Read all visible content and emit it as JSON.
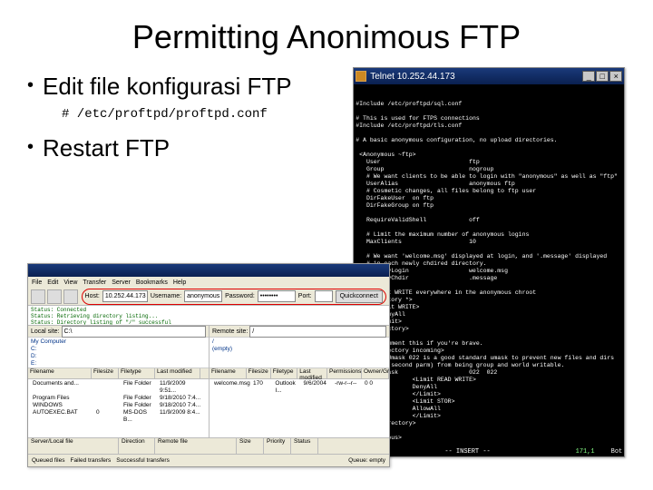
{
  "title": "Permitting Anonimous FTP",
  "bullets": {
    "edit": "Edit file konfigurasi FTP",
    "restart": "Restart FTP"
  },
  "code": "# /etc/proftpd/proftpd.conf",
  "terminal": {
    "window_title": "Telnet 10.252.44.173",
    "buttons": {
      "min": "_",
      "max": "□",
      "close": "×"
    },
    "lines": [
      "#Include /etc/proftpd/sql.conf",
      "",
      "# This is used for FTPS connections",
      "#Include /etc/proftpd/tls.conf",
      "",
      "# A basic anonymous configuration, no upload directories.",
      "",
      " <Anonymous ~ftp>",
      "   User                         ftp",
      "   Group                        nogroup",
      "   # We want clients to be able to login with \"anonymous\" as well as \"ftp\"",
      "   UserAlias                    anonymous ftp",
      "   # Cosmetic changes, all files belong to ftp user",
      "   DirFakeUser  on ftp",
      "   DirFakeGroup on ftp",
      "",
      "   RequireValidShell            off",
      "",
      "   # Limit the maximum number of anonymous logins",
      "   MaxClients                   10",
      "",
      "   # We want 'welcome.msg' displayed at login, and '.message' displayed",
      "   # in each newly chdired directory.",
      "   DisplayLogin                 welcome.msg",
      "   DisplayChdir                 .message",
      "",
      "   # Limit WRITE everywhere in the anonymous chroot",
      "   <Directory *>",
      "     <Limit WRITE>",
      "       DenyAll",
      "     </Limit>",
      "   </Directory>",
      "",
      "   # Uncomment this if you're brave.",
      "   # <Directory incoming>",
      "   #   # Umask 022 is a good standard umask to prevent new files and dirs",
      "   #   # (second parm) from being group and world writable.",
      "   #   Umask                    022  022",
      "   #            <Limit READ WRITE>",
      "   #            DenyAll",
      "   #            </Limit>",
      "   #            <Limit STOR>",
      "   #            AllowAll",
      "   #            </Limit>",
      "   # </Directory>",
      "",
      " </Anonymous>"
    ],
    "status": {
      "left": "~",
      "mode": "-- INSERT --",
      "pos": "171,1",
      "pct": "Bot"
    }
  },
  "ftp": {
    "menu": [
      "File",
      "Edit",
      "View",
      "Transfer",
      "Server",
      "Bookmarks",
      "Help"
    ],
    "connect": {
      "host_label": "Host:",
      "host": "10.252.44.173",
      "user_label": "Username:",
      "user": "anonymous",
      "pass_label": "Password:",
      "pass": "••••••••",
      "port_label": "Port:",
      "port": "",
      "button": "Quickconnect"
    },
    "log_lines": [
      "Status:  Connected",
      "Status:  Retrieving directory listing...",
      "Status:  Directory listing of \"/\" successful"
    ],
    "local": {
      "label": "Local site:",
      "path": "C:\\",
      "tree": [
        "My Computer",
        "  C:",
        "  D:",
        "  E:"
      ],
      "headers": [
        "Filename",
        "Filesize",
        "Filetype",
        "Last modified"
      ],
      "rows": [
        {
          "name": "Documents and...",
          "size": "",
          "type": "File Folder",
          "mod": "11/9/2009 9:51..."
        },
        {
          "name": "Program Files",
          "size": "",
          "type": "File Folder",
          "mod": "9/18/2010 7:4..."
        },
        {
          "name": "WINDOWS",
          "size": "",
          "type": "File Folder",
          "mod": "9/18/2010 7:4..."
        },
        {
          "name": "AUTOEXEC.BAT",
          "size": "0",
          "type": "MS-DOS B...",
          "mod": "11/9/2009 8:4..."
        }
      ]
    },
    "remote": {
      "label": "Remote site:",
      "path": "/",
      "tree": [
        "/",
        "  (empty)"
      ],
      "headers": [
        "Filename",
        "Filesize",
        "Filetype",
        "Last modified",
        "Permissions",
        "Owner/Gr..."
      ],
      "rows": [
        {
          "name": "welcome.msg",
          "size": "170",
          "type": "Outlook I...",
          "mod": "9/6/2004",
          "perm": "-rw-r--r--",
          "own": "0 0"
        }
      ]
    },
    "queue_headers": [
      "Server/Local file",
      "Direction",
      "Remote file",
      "Size",
      "Priority",
      "Status"
    ],
    "statusbar": {
      "queued": "Queued files",
      "failed": "Failed transfers",
      "ok": "Successful transfers",
      "empty": "Queue: empty"
    }
  }
}
